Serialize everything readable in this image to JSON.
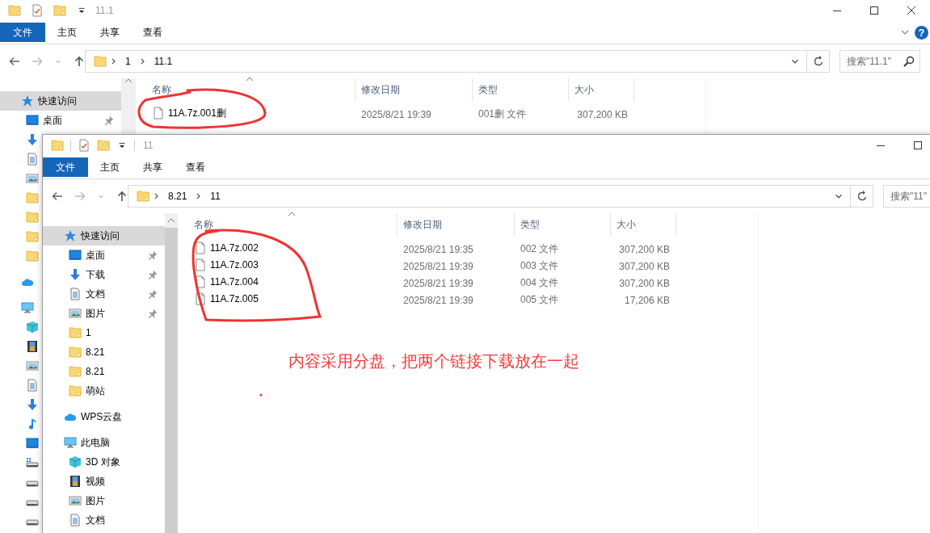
{
  "windows": [
    {
      "title": "11.1",
      "ribbon_tabs": [
        {
          "label": "文件",
          "selected": true
        },
        {
          "label": "主页",
          "selected": false
        },
        {
          "label": "共享",
          "selected": false
        },
        {
          "label": "查看",
          "selected": false
        }
      ],
      "help": "?",
      "path": [
        "1",
        "11.1"
      ],
      "search": {
        "placeholder": "搜索\"11.1\""
      },
      "nav": [
        {
          "label": "快速访问",
          "kind": "star",
          "selected": true,
          "children": [
            {
              "label": "桌面",
              "kind": "desktop",
              "pinned": true,
              "selected": false
            },
            {
              "kind": "download",
              "selected": false
            },
            {
              "kind": "doc",
              "selected": false
            },
            {
              "kind": "picture",
              "selected": false
            },
            {
              "kind": "folder",
              "selected": false
            },
            {
              "kind": "folder",
              "selected": false
            },
            {
              "kind": "folder",
              "selected": false
            },
            {
              "kind": "folder",
              "selected": false
            }
          ]
        },
        {
          "kind": "cloud",
          "selected": false
        },
        {
          "kind": "pc",
          "selected": false,
          "children": [
            {
              "kind": "cube",
              "selected": false
            },
            {
              "kind": "film",
              "selected": false
            },
            {
              "kind": "picture",
              "selected": false
            },
            {
              "kind": "doc",
              "selected": false
            },
            {
              "kind": "download",
              "selected": false
            },
            {
              "kind": "music",
              "selected": false
            },
            {
              "kind": "desktop",
              "selected": false
            },
            {
              "kind": "drive-win",
              "selected": false
            },
            {
              "kind": "drive",
              "selected": false
            },
            {
              "kind": "drive",
              "selected": false
            },
            {
              "kind": "drive",
              "selected": false
            }
          ]
        }
      ],
      "columns": [
        "名称",
        "修改日期",
        "类型",
        "大小"
      ],
      "rows": [
        {
          "name": "11A.7z.001删",
          "modified": "2025/8/21 19:39",
          "type": "001删 文件",
          "size": "307,200 KB"
        }
      ]
    },
    {
      "title": "11",
      "ribbon_tabs": [
        {
          "label": "文件",
          "selected": true
        },
        {
          "label": "主页",
          "selected": false
        },
        {
          "label": "共享",
          "selected": false
        },
        {
          "label": "查看",
          "selected": false
        }
      ],
      "path": [
        "8.21",
        "11"
      ],
      "search": {
        "placeholder": "搜索\"11\""
      },
      "nav": [
        {
          "label": "快速访问",
          "kind": "star",
          "selected": true,
          "children": [
            {
              "label": "桌面",
              "kind": "desktop",
              "pinned": true,
              "selected": false
            },
            {
              "label": "下载",
              "kind": "download",
              "pinned": true,
              "selected": false
            },
            {
              "label": "文档",
              "kind": "doc",
              "pinned": true,
              "selected": false
            },
            {
              "label": "图片",
              "kind": "picture",
              "pinned": true,
              "selected": false
            },
            {
              "label": "1",
              "kind": "folder",
              "pinned": false,
              "selected": false
            },
            {
              "label": "8.21",
              "kind": "folder",
              "pinned": false,
              "selected": false
            },
            {
              "label": "8.21",
              "kind": "folder",
              "pinned": false,
              "selected": false
            },
            {
              "label": "萌站",
              "kind": "folder",
              "pinned": false,
              "selected": false
            }
          ]
        },
        {
          "label": "WPS云盘",
          "kind": "cloud",
          "selected": false
        },
        {
          "label": "此电脑",
          "kind": "pc",
          "selected": false,
          "children": [
            {
              "label": "3D 对象",
              "kind": "cube",
              "pinned": false,
              "selected": false
            },
            {
              "label": "视频",
              "kind": "film",
              "pinned": false,
              "selected": false
            },
            {
              "label": "图片",
              "kind": "picture",
              "pinned": false,
              "selected": false
            },
            {
              "label": "文档",
              "kind": "doc",
              "pinned": false,
              "selected": false
            }
          ]
        }
      ],
      "columns": [
        "名称",
        "修改日期",
        "类型",
        "大小"
      ],
      "rows": [
        {
          "name": "11A.7z.002",
          "modified": "2025/8/21 19:35",
          "type": "002 文件",
          "size": "307,200 KB"
        },
        {
          "name": "11A.7z.003",
          "modified": "2025/8/21 19:39",
          "type": "003 文件",
          "size": "307,200 KB"
        },
        {
          "name": "11A.7z.004",
          "modified": "2025/8/21 19:39",
          "type": "004 文件",
          "size": "307,200 KB"
        },
        {
          "name": "11A.7z.005",
          "modified": "2025/8/21 19:39",
          "type": "005 文件",
          "size": "17,206 KB"
        }
      ]
    }
  ],
  "annotation": {
    "note": "内容采用分盘，把两个链接下载放在一起"
  }
}
